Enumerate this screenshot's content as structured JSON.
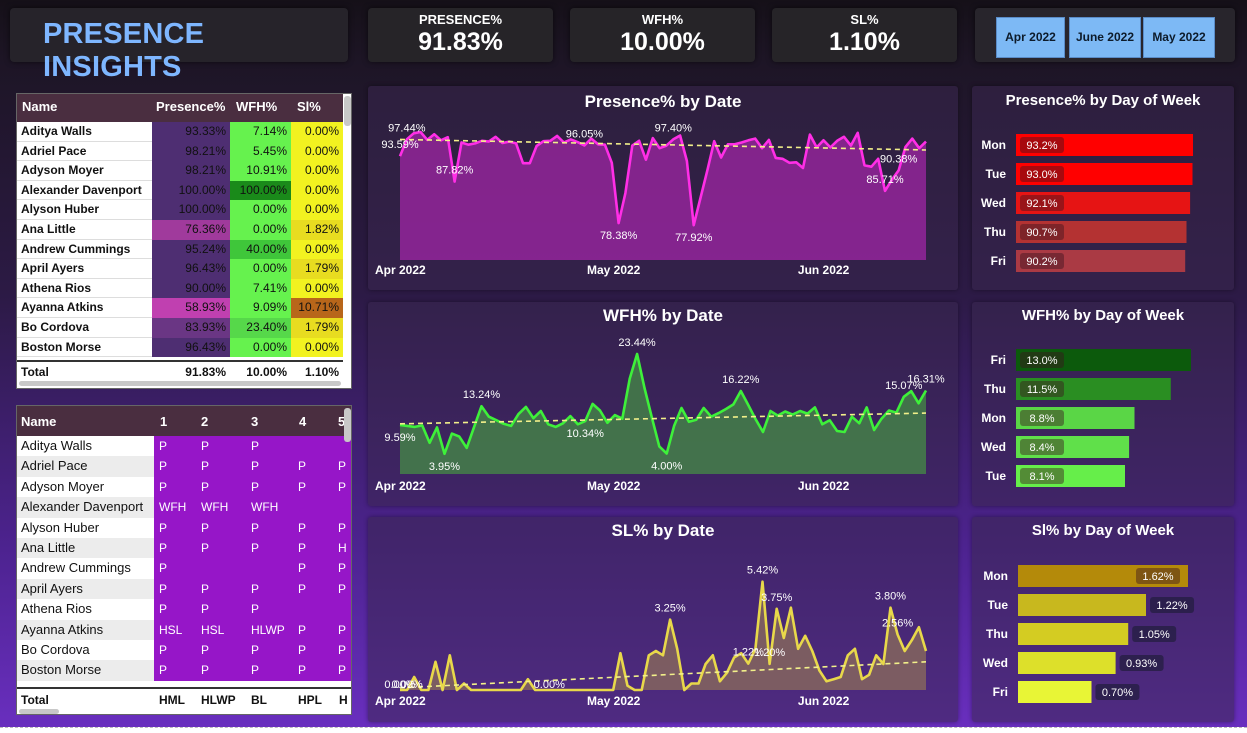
{
  "header": {
    "title": "PRESENCE INSIGHTS"
  },
  "kpis": [
    {
      "label": "PRESENCE%",
      "value": "91.83%"
    },
    {
      "label": "WFH%",
      "value": "10.00%"
    },
    {
      "label": "SL%",
      "value": "1.10%"
    }
  ],
  "month_slicer": [
    "Apr 2022",
    "June 2022",
    "May 2022"
  ],
  "summary_table": {
    "headers": [
      "Name",
      "Presence%",
      "WFH%",
      "Sl%"
    ],
    "rows": [
      {
        "name": "Aditya Walls",
        "presence": "93.33%",
        "wfh": "7.14%",
        "sl": "0.00%"
      },
      {
        "name": "Adriel Pace",
        "presence": "98.21%",
        "wfh": "5.45%",
        "sl": "0.00%"
      },
      {
        "name": "Adyson Moyer",
        "presence": "98.21%",
        "wfh": "10.91%",
        "sl": "0.00%"
      },
      {
        "name": "Alexander Davenport",
        "presence": "100.00%",
        "wfh": "100.00%",
        "sl": "0.00%"
      },
      {
        "name": "Alyson Huber",
        "presence": "100.00%",
        "wfh": "0.00%",
        "sl": "0.00%"
      },
      {
        "name": "Ana Little",
        "presence": "76.36%",
        "wfh": "0.00%",
        "sl": "1.82%"
      },
      {
        "name": "Andrew Cummings",
        "presence": "95.24%",
        "wfh": "40.00%",
        "sl": "0.00%"
      },
      {
        "name": "April Ayers",
        "presence": "96.43%",
        "wfh": "0.00%",
        "sl": "1.79%"
      },
      {
        "name": "Athena Rios",
        "presence": "90.00%",
        "wfh": "7.41%",
        "sl": "0.00%"
      },
      {
        "name": "Ayanna Atkins",
        "presence": "58.93%",
        "wfh": "9.09%",
        "sl": "10.71%"
      },
      {
        "name": "Bo Cordova",
        "presence": "83.93%",
        "wfh": "23.40%",
        "sl": "1.79%"
      },
      {
        "name": "Boston Morse",
        "presence": "96.43%",
        "wfh": "0.00%",
        "sl": "0.00%"
      }
    ],
    "total": {
      "label": "Total",
      "presence": "91.83%",
      "wfh": "10.00%",
      "sl": "1.10%"
    }
  },
  "attendance_table": {
    "headers": [
      "Name",
      "1",
      "2",
      "3",
      "4",
      "5"
    ],
    "rows": [
      {
        "name": "Aditya Walls",
        "days": [
          "P",
          "P",
          "P",
          "",
          ""
        ]
      },
      {
        "name": "Adriel Pace",
        "days": [
          "P",
          "P",
          "P",
          "P",
          "P"
        ]
      },
      {
        "name": "Adyson Moyer",
        "days": [
          "P",
          "P",
          "P",
          "P",
          "P"
        ]
      },
      {
        "name": "Alexander Davenport",
        "days": [
          "WFH",
          "WFH",
          "WFH",
          "",
          ""
        ]
      },
      {
        "name": "Alyson Huber",
        "days": [
          "P",
          "P",
          "P",
          "P",
          "P"
        ]
      },
      {
        "name": "Ana Little",
        "days": [
          "P",
          "P",
          "P",
          "P",
          "H"
        ]
      },
      {
        "name": "Andrew Cummings",
        "days": [
          "P",
          "",
          "",
          "P",
          "P"
        ]
      },
      {
        "name": "April Ayers",
        "days": [
          "P",
          "P",
          "P",
          "P",
          "P"
        ]
      },
      {
        "name": "Athena Rios",
        "days": [
          "P",
          "P",
          "P",
          "",
          ""
        ]
      },
      {
        "name": "Ayanna Atkins",
        "days": [
          "HSL",
          "HSL",
          "HLWP",
          "P",
          "P"
        ]
      },
      {
        "name": "Bo Cordova",
        "days": [
          "P",
          "P",
          "P",
          "P",
          "P"
        ]
      },
      {
        "name": "Boston Morse",
        "days": [
          "P",
          "P",
          "P",
          "P",
          "P"
        ]
      }
    ],
    "total": {
      "label": "Total",
      "days": [
        "HML",
        "HLWP",
        "BL",
        "HPL",
        "H"
      ]
    }
  },
  "colors": {
    "presence_line": "#ff2ee6",
    "wfh_line": "#3ef03a",
    "sl_line": "#e8d84a",
    "trend": "#f2f08a",
    "title_blue": "#7eb6ff"
  },
  "chart_data": [
    {
      "type": "area",
      "title": "Presence% by Date",
      "x_ticks": [
        "Apr 2022",
        "May 2022",
        "Jun 2022"
      ],
      "x_start": "2022-04-01",
      "x_end": "2022-06-30",
      "ylim": [
        70,
        100
      ],
      "values": [
        93.59,
        97.44,
        98.8,
        99.1,
        97.3,
        98.6,
        97.2,
        97.9,
        87.82,
        96.7,
        96.2,
        96.5,
        97.1,
        96.9,
        98.0,
        96.6,
        96.9,
        96.5,
        92.0,
        92.0,
        95.9,
        97.0,
        97.1,
        98.2,
        96.7,
        97.4,
        96.8,
        96.05,
        97.6,
        96.3,
        96.2,
        92.1,
        78.38,
        85.2,
        96.0,
        97.1,
        92.8,
        97.7,
        95.4,
        96.0,
        97.4,
        98.3,
        92.5,
        77.92,
        84.2,
        90.4,
        97.0,
        93.3,
        96.3,
        96.3,
        96.7,
        97.2,
        97.6,
        95.4,
        97.3,
        93.2,
        93.0,
        92.1,
        92.2,
        90.9,
        98.5,
        95.6,
        97.2,
        95.6,
        97.1,
        98.0,
        96.0,
        98.9,
        91.5,
        91.2,
        93.0,
        85.71,
        88.2,
        90.38,
        95.7,
        97.6,
        95.4,
        96.9
      ],
      "labels": [
        {
          "idx": 0,
          "text": "93.59%"
        },
        {
          "idx": 1,
          "text": "97.44%"
        },
        {
          "idx": 8,
          "text": "87.82%"
        },
        {
          "idx": 27,
          "text": "96.05%"
        },
        {
          "idx": 32,
          "text": "78.38%"
        },
        {
          "idx": 40,
          "text": "97.40%"
        },
        {
          "idx": 43,
          "text": "77.92%"
        },
        {
          "idx": 71,
          "text": "85.71%"
        },
        {
          "idx": 73,
          "text": "90.38%"
        }
      ],
      "trend": [
        97.4,
        95.0
      ]
    },
    {
      "type": "area",
      "title": "WFH% by Date",
      "x_ticks": [
        "Apr 2022",
        "May 2022",
        "Jun 2022"
      ],
      "x_start": "2022-04-01",
      "x_end": "2022-06-30",
      "ylim": [
        0,
        25
      ],
      "values": [
        9.59,
        9.4,
        9.2,
        9.5,
        6.1,
        9.1,
        3.95,
        7.9,
        7.3,
        5.1,
        9.2,
        13.24,
        11.2,
        10.5,
        9.8,
        9.4,
        11.7,
        13.1,
        10.9,
        12.3,
        9.7,
        9.2,
        9.9,
        11.3,
        9.7,
        10.34,
        13.7,
        12.4,
        10.0,
        11.5,
        10.8,
        18.6,
        23.44,
        16.8,
        11.0,
        5.4,
        4.0,
        9.4,
        12.9,
        10.2,
        10.6,
        12.9,
        11.2,
        11.9,
        12.7,
        13.6,
        16.22,
        13.5,
        10.7,
        8.2,
        12.3,
        11.4,
        12.2,
        11.6,
        12.3,
        11.8,
        13.0,
        9.7,
        10.5,
        8.4,
        8.2,
        11.2,
        9.9,
        13.0,
        8.6,
        10.8,
        12.4,
        12.0,
        15.07,
        16.2,
        13.8,
        16.31
      ],
      "labels": [
        {
          "idx": 0,
          "text": "9.59%"
        },
        {
          "idx": 6,
          "text": "3.95%"
        },
        {
          "idx": 11,
          "text": "13.24%"
        },
        {
          "idx": 25,
          "text": "10.34%"
        },
        {
          "idx": 32,
          "text": "23.44%"
        },
        {
          "idx": 36,
          "text": "4.00%"
        },
        {
          "idx": 46,
          "text": "16.22%"
        },
        {
          "idx": 68,
          "text": "15.07%"
        },
        {
          "idx": 71,
          "text": "16.31%"
        }
      ],
      "trend": [
        9.8,
        11.9
      ]
    },
    {
      "type": "area",
      "title": "SL% by Date",
      "x_ticks": [
        "Apr 2022",
        "May 2022",
        "Jun 2022"
      ],
      "x_start": "2022-04-01",
      "x_end": "2022-06-30",
      "ylim": [
        0,
        6
      ],
      "values": [
        0.0,
        0.0,
        0.6,
        0.0,
        0.0,
        1.3,
        0.0,
        1.6,
        0.0,
        0.3,
        0.0,
        0.0,
        0.0,
        0.0,
        0.0,
        0.0,
        0.0,
        0.0,
        0.5,
        0.0,
        0.0,
        0.0,
        0.0,
        0.0,
        0.0,
        0.0,
        0.0,
        0.0,
        0.0,
        0.0,
        0.0,
        1.7,
        0.2,
        0.0,
        0.0,
        1.6,
        1.8,
        1.6,
        3.25,
        1.9,
        0.0,
        0.3,
        0.3,
        1.2,
        1.6,
        0.4,
        0.8,
        1.5,
        1.7,
        1.22,
        1.9,
        5.0,
        1.2,
        3.75,
        2.4,
        3.8,
        1.9,
        2.5,
        1.8,
        0.9,
        0.4,
        0.5,
        0.6,
        1.6,
        1.9,
        0.5,
        0.7,
        1.6,
        1.2,
        3.8,
        2.56,
        1.8,
        2.3,
        2.9,
        1.8
      ],
      "labels": [
        {
          "idx": 0,
          "text": "0.00%"
        },
        {
          "idx": 1,
          "text": "0.00%"
        },
        {
          "idx": 21,
          "text": "0.00%"
        },
        {
          "idx": 38,
          "text": "3.25%"
        },
        {
          "idx": 49,
          "text": "1.22%"
        },
        {
          "idx": 51,
          "text": "5.42%"
        },
        {
          "idx": 52,
          "text": "1.20%"
        },
        {
          "idx": 53,
          "text": "3.75%"
        },
        {
          "idx": 69,
          "text": "3.80%"
        },
        {
          "idx": 70,
          "text": "2.56%"
        }
      ],
      "trend": [
        0.1,
        1.3
      ]
    },
    {
      "type": "bar",
      "title": "Presence% by Day of Week",
      "categories": [
        "Mon",
        "Tue",
        "Wed",
        "Thu",
        "Fri"
      ],
      "values": [
        93.2,
        93.0,
        92.1,
        90.7,
        90.2
      ],
      "value_labels": [
        "93.2%",
        "93.0%",
        "92.1%",
        "90.7%",
        "90.2%"
      ],
      "colors": [
        "#ff0000",
        "#ff0000",
        "#e61414",
        "#b43232",
        "#aa3a44"
      ]
    },
    {
      "type": "bar",
      "title": "WFH% by Day of Week",
      "categories": [
        "Fri",
        "Thu",
        "Mon",
        "Wed",
        "Tue"
      ],
      "values": [
        13.0,
        11.5,
        8.8,
        8.4,
        8.1
      ],
      "value_labels": [
        "13.0%",
        "11.5%",
        "8.8%",
        "8.4%",
        "8.1%"
      ],
      "colors": [
        "#0c5a0c",
        "#2a8e22",
        "#5ad646",
        "#60e04a",
        "#66ee4a"
      ]
    },
    {
      "type": "bar",
      "title": "Sl% by Day of Week",
      "categories": [
        "Mon",
        "Tue",
        "Thu",
        "Wed",
        "Fri"
      ],
      "values": [
        1.62,
        1.22,
        1.05,
        0.93,
        0.7
      ],
      "value_labels": [
        "1.62%",
        "1.22%",
        "1.05%",
        "0.93%",
        "0.70%"
      ],
      "colors": [
        "#b48a0a",
        "#c8b81e",
        "#d4cc22",
        "#dde02a",
        "#e8f536"
      ]
    }
  ]
}
